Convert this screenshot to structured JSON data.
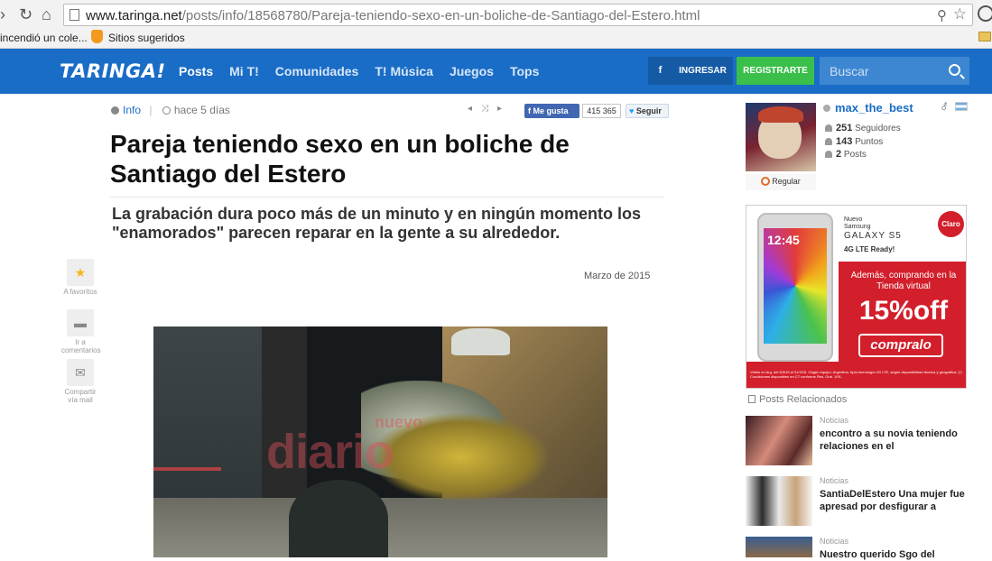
{
  "browser": {
    "url_host": "www.taringa.net",
    "url_path": "/posts/info/18568780/Pareja-teniendo-sexo-en-un-boliche-de-Santiago-del-Estero.html",
    "bookmarks": [
      "incendió un cole...",
      "Sitios sugeridos"
    ]
  },
  "header": {
    "logo": "TARINGA!",
    "nav": [
      "Posts",
      "Mi T!",
      "Comunidades",
      "T! Música",
      "Juegos",
      "Tops"
    ],
    "fb_label": "f",
    "login_label": "INGRESAR",
    "register_label": "REGISTRARTE",
    "search_placeholder": "Buscar"
  },
  "article": {
    "category": "Info",
    "age": "hace 5 días",
    "like_label": "Me gusta",
    "like_count": "415 365",
    "follow_label": "Seguir",
    "title": "Pareja teniendo sexo en un boliche de Santiago del Estero",
    "subtitle": "La grabación dura poco más de un minuto y en ningún momento los \"enamorados\" parecen reparar en la gente a su alrededor.",
    "date": "Marzo de 2015",
    "side_actions": [
      "A favoritos",
      "Ir a comentarios",
      "Compartir vía mail"
    ],
    "video_watermark": "diario",
    "video_watermark_small": "nuevo"
  },
  "author": {
    "username": "max_the_best",
    "rank": "Regular",
    "followers_count": "251",
    "followers_label": "Seguidores",
    "points_count": "143",
    "points_label": "Puntos",
    "posts_count": "2",
    "posts_label": "Posts"
  },
  "ad": {
    "brand": "Claro",
    "product_line1": "Nuevo",
    "product_line2": "Samsung",
    "product": "GALAXY S5",
    "network": "4G LTE Ready!",
    "phone_time": "12:45",
    "offer_text": "Además, comprando en la Tienda virtual",
    "discount": "15%off",
    "cta": "compralo",
    "legal": "Válido en Arg. del 6/3/15 al 31/3/15. Origen equipo: Argentina. Apto tecnología 4G LTE, según disponibilidad técnica y geográfica. (*) Condiciones disponibles en CT conforme Res. Gral. 1/91."
  },
  "related": {
    "heading": "Posts Relacionados",
    "items": [
      {
        "category": "Noticias",
        "title": "encontro a su novia teniendo relaciones en el"
      },
      {
        "category": "Noticias",
        "title": "SantiaDelEstero Una mujer fue apresad por desfigurar a"
      },
      {
        "category": "Noticias",
        "title": "Nuestro querido Sgo del"
      }
    ]
  },
  "colors": {
    "brand_blue": "#1a6dc6",
    "register_green": "#3ac04a",
    "ad_red": "#d21f2b"
  }
}
